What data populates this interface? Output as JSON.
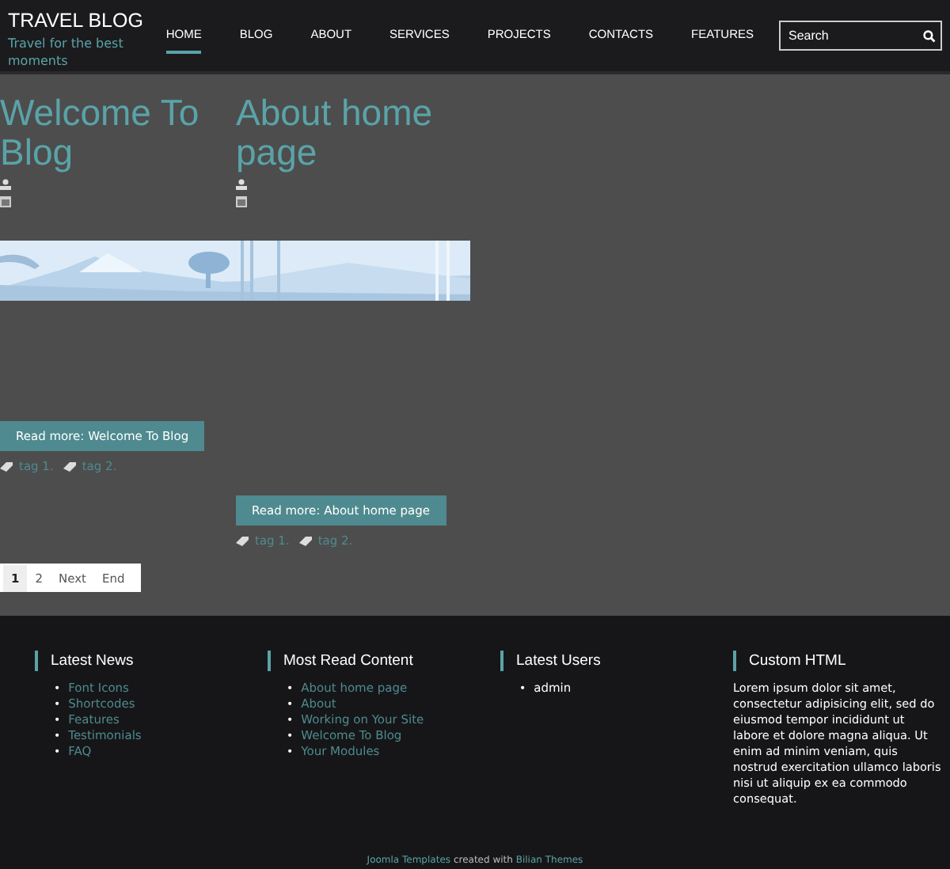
{
  "site": {
    "title": "TRAVEL BLOG",
    "tagline": "Travel for the best moments"
  },
  "nav": [
    {
      "label": "HOME",
      "selected": true
    },
    {
      "label": "BLOG",
      "selected": false
    },
    {
      "label": "ABOUT",
      "selected": false
    },
    {
      "label": "SERVICES",
      "selected": false
    },
    {
      "label": "PROJECTS",
      "selected": false
    },
    {
      "label": "CONTACTS",
      "selected": false
    },
    {
      "label": "FEATURES",
      "selected": false
    }
  ],
  "search": {
    "placeholder": "Search"
  },
  "articles": [
    {
      "title": "Welcome To Blog",
      "has_picture": true,
      "read_more": "Read more: Welcome To Blog",
      "tags": [
        "tag 1.",
        "tag 2."
      ]
    },
    {
      "title": "About home page",
      "has_picture": false,
      "read_more": "Read more: About home page",
      "tags": [
        "tag 1.",
        "tag 2."
      ]
    }
  ],
  "pagination": [
    {
      "label": "1",
      "selected": true
    },
    {
      "label": "2",
      "selected": false
    },
    {
      "label": "Next",
      "selected": false
    },
    {
      "label": "End",
      "selected": false
    }
  ],
  "footer_modules": [
    {
      "kind": "links",
      "title": "Latest News",
      "bullet": "•",
      "items": [
        "Font Icons",
        "Shortcodes",
        "Features",
        "Testimonials",
        "FAQ"
      ]
    },
    {
      "kind": "links",
      "title": "Most Read Content",
      "bullet": "•",
      "items": [
        "About home page",
        "About",
        "Working on Your Site",
        "Welcome To Blog",
        "Your Modules"
      ]
    },
    {
      "kind": "list",
      "title": "Latest Users",
      "bullet": "•",
      "items": [
        "admin"
      ]
    },
    {
      "kind": "text",
      "title": "Custom HTML",
      "text": "Lorem ipsum dolor sit amet, consectetur adipisicing elit, sed do eiusmod tempor incididunt ut labore et dolore magna aliqua. Ut enim ad minim veniam, quis nostrud exercitation ullamco laboris nisi ut aliquip ex ea commodo consequat."
    }
  ],
  "credits": {
    "link1": "Joomla Templates",
    "middle": "created with",
    "link2": "Bilian Themes"
  }
}
